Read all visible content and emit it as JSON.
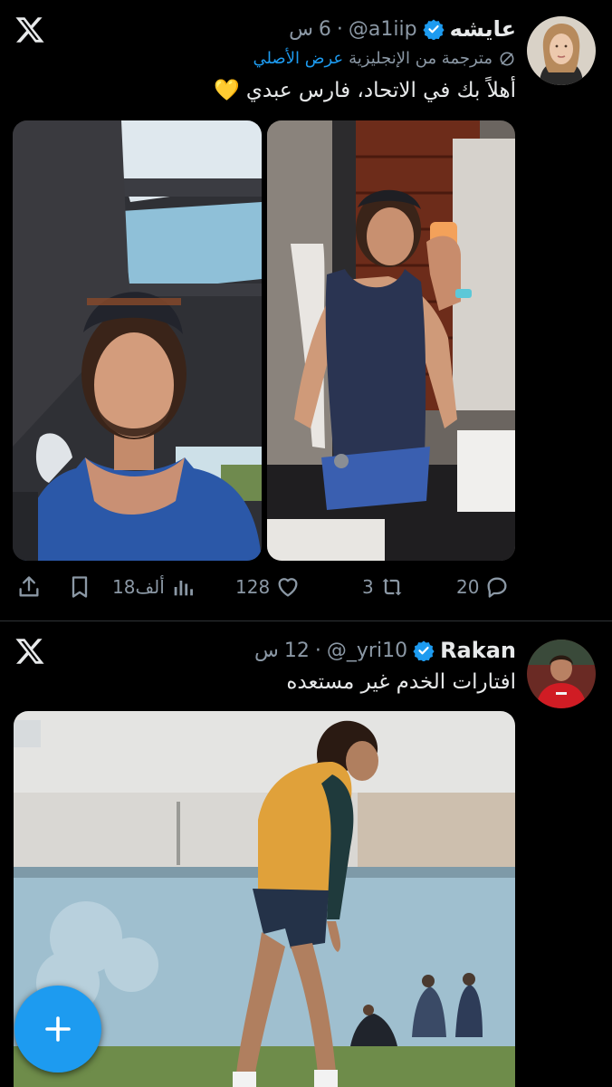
{
  "tweet1": {
    "display_name": "عايشه",
    "handle": "@a1iip",
    "time": "6",
    "time_unit": "س",
    "translated_label": "مترجمة من الإنجليزية",
    "show_original": "عرض الأصلي",
    "text": "أهلاً بك في الاتحاد، فارس عبدي 💛",
    "replies": "20",
    "reposts": "3",
    "likes": "128",
    "views": "18ألف"
  },
  "tweet2": {
    "display_name": "Rakan",
    "handle": "@_yri10",
    "time": "12",
    "time_unit": "س",
    "text": "افتارات الخدم غير مستعده"
  },
  "icons": {
    "x_logo": "x-logo-icon",
    "verified": "verified-badge-icon",
    "reply": "reply-icon",
    "repost": "repost-icon",
    "like": "heart-icon",
    "views": "views-icon",
    "bookmark": "bookmark-icon",
    "share": "share-icon",
    "compose": "plus-icon"
  },
  "colors": {
    "background": "#000000",
    "accent": "#1d9bf0",
    "secondary_text": "#8b98a5",
    "divider": "#2f3336"
  }
}
